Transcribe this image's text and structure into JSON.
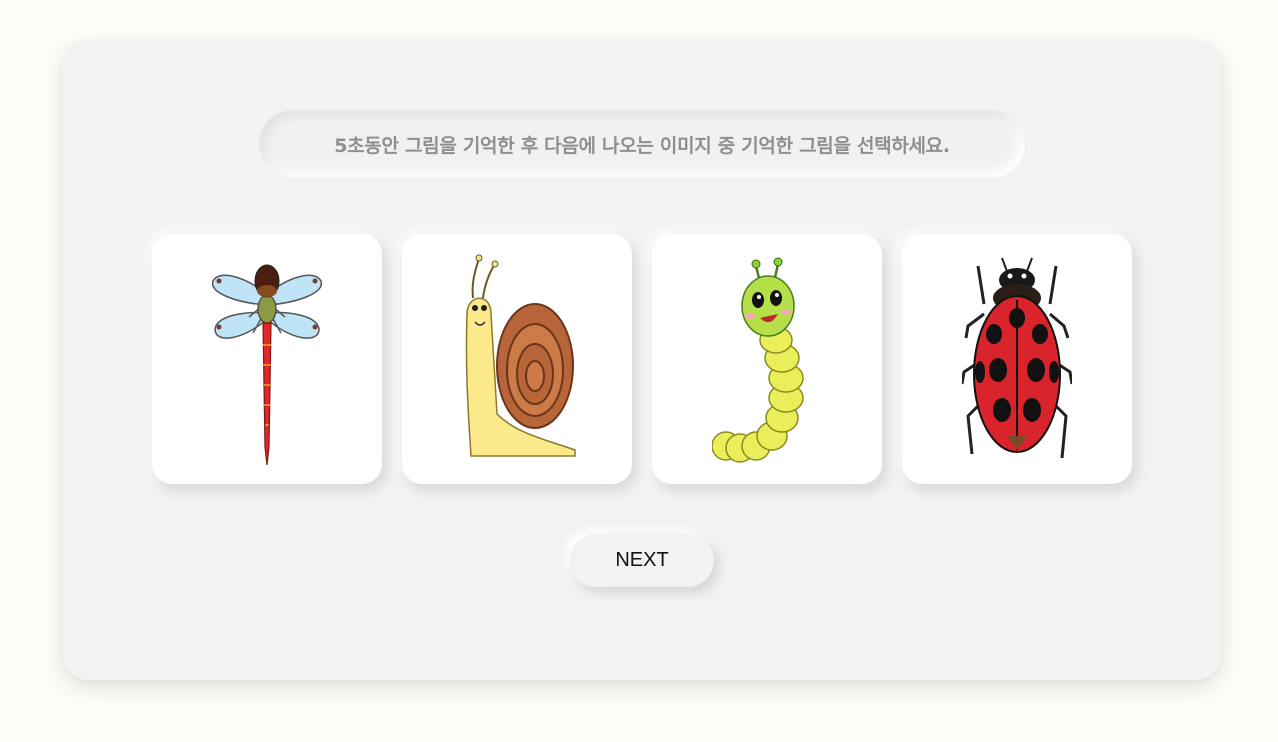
{
  "instruction": "5초동안 그림을 기억한 후 다음에 나오는 이미지 중 기억한 그림을 선택하세요.",
  "cards": [
    {
      "name": "dragonfly",
      "icon": "dragonfly-icon"
    },
    {
      "name": "snail",
      "icon": "snail-icon"
    },
    {
      "name": "caterpillar",
      "icon": "caterpillar-icon"
    },
    {
      "name": "ladybug",
      "icon": "ladybug-icon"
    }
  ],
  "next_label": "NEXT",
  "colors": {
    "background": "#fdfcf7",
    "panel": "#f2f2f2",
    "instruction_text": "#8f8f8f",
    "card": "#ffffff"
  }
}
